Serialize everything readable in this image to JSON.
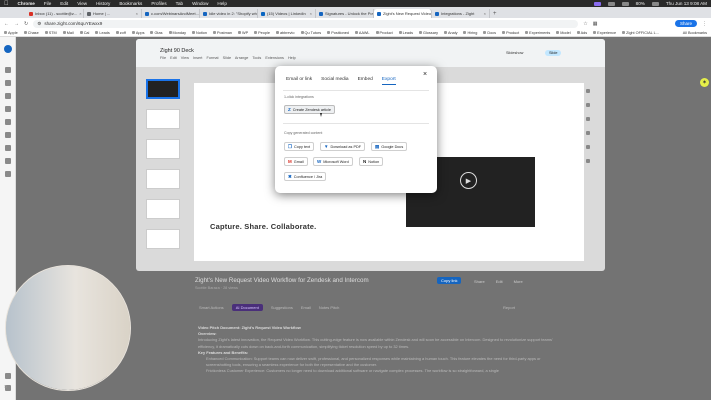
{
  "menubar": {
    "items": [
      "Chrome",
      "File",
      "Edit",
      "View",
      "History",
      "Bookmarks",
      "Profiles",
      "Tab",
      "Window",
      "Help"
    ],
    "battery": "80%",
    "clock": "Thu Jun 13 9:08 AM"
  },
  "tabs": [
    {
      "label": "Inbox (11) - scottie@z...",
      "color": "#d93025"
    },
    {
      "label": "Home | ...",
      "color": "#5f6368"
    },
    {
      "label": "c.com/WebinarsAndMeet...",
      "color": "#1565c0"
    },
    {
      "label": "Idle video in 2: \"Shopify wh...",
      "color": "#1565c0"
    },
    {
      "label": "(15) Videos | LinkedIn",
      "color": "#0a66c2"
    },
    {
      "label": "Signatures - Unlock the Pow...",
      "color": "#1565c0"
    },
    {
      "label": "Zight's New Request Video ...",
      "color": "#1565c0"
    },
    {
      "label": "Integrations - Zight",
      "color": "#1565c0"
    }
  ],
  "address": {
    "url": "share.zight.com/6quYEwxx9",
    "share_label": "Share"
  },
  "bookmarks": [
    "Apple",
    "Chase",
    "STM",
    "Mail",
    "Cal",
    "Leads",
    "zoff",
    "Apps",
    "Gtas",
    "Monday",
    "Notion",
    "Postman",
    "WP",
    "People",
    "abbrevio",
    "Qu Tutors",
    "Positioned",
    "AAWL",
    "Product",
    "Leads",
    "Glossary",
    "Analy",
    "Hiring",
    "Docs",
    "Product",
    "Experiments",
    "Model",
    "Ads",
    "Experience",
    "Zight OFFICIAL L..."
  ],
  "bookmarks_all": "All Bookmarks",
  "slides": {
    "title": "Zight 90 Deck",
    "menu": "File Edit View Insert Format Slide Arrange Tools Extensions Help",
    "tagline": "Capture. Share. Collaborate.",
    "present_label": "Slide",
    "slideshow_label": "Slideshow"
  },
  "modal": {
    "tabs": [
      "Email or link",
      "Social media",
      "Embed",
      "Export"
    ],
    "active_tab": "Export",
    "section1": "1-click integrations",
    "create_zendesk": "Create Zendesk article",
    "section2": "Copy generated content",
    "buttons": [
      "Copy text",
      "Download as PDF",
      "Google Docs",
      "Gmail",
      "Microsoft Word",
      "Notion",
      "Confluence / Jira"
    ]
  },
  "video": {
    "title": "Zight's New Request Video Workflow for Zendesk and Intercom",
    "meta": "Scottie Baraza · 28 views",
    "copy_link": "Copy link",
    "actions": [
      "Share",
      "Edit",
      "More"
    ],
    "subtabs": [
      "Smart Actions",
      "AI Document",
      "Suggestions",
      "Email",
      "Notes Pitch"
    ],
    "report": "Report",
    "doc_title": "Video Pitch Document: Zight's Request Video Workflow",
    "doc_overview_h": "Overview:",
    "doc_overview": "Introducing Zight's latest innovation, the Request Video Workflow. This cutting-edge feature is now available within Zendesk and will soon be accessible on Intercom. Designed to revolutionize support teams' efficiency, it dramatically cuts down on back-and-forth communication, simplifying ticket resolution speed by up to 32 times.",
    "doc_key_h": "Key Features and Benefits:",
    "doc_key1": "Enhanced Communication: Support teams can now deliver swift, professional, and personalized responses while maintaining a human touch. This feature elevates the need for third-party apps or screenshotting tools, ensuring a seamless experience for both the representative and the customer.",
    "doc_key2": "Frictionless Customer Experience: Customers no longer need to download additional software or navigate complex processes. The workflow is so straightforward, a single"
  }
}
